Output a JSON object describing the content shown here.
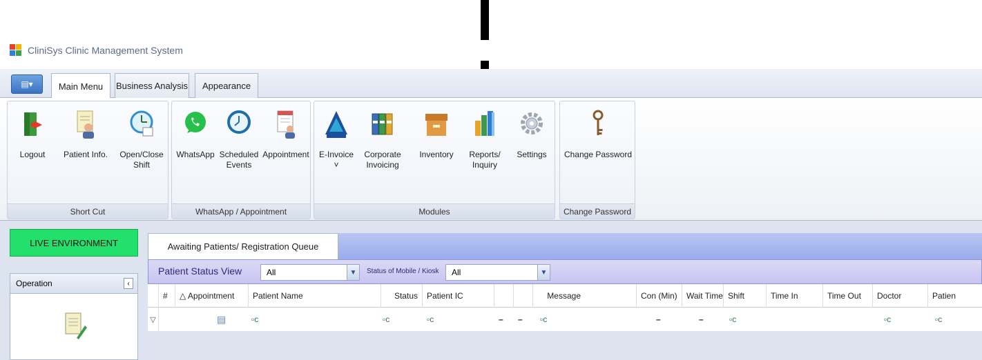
{
  "window": {
    "title": "CliniSys Clinic Management System"
  },
  "tabs": [
    {
      "label": "Main Menu",
      "active": true
    },
    {
      "label": "Business Analysis",
      "active": false
    },
    {
      "label": "Appearance",
      "active": false
    }
  ],
  "app_menu_glyph": "▤▾",
  "ribbon": {
    "groups": [
      {
        "label": "Short Cut",
        "buttons": [
          {
            "label": "Logout",
            "icon": "door-exit-icon"
          },
          {
            "label": "Patient Info.",
            "icon": "patient-doc-icon"
          },
          {
            "label": "Open/Close\nShift",
            "icon": "clock-calendar-icon"
          }
        ]
      },
      {
        "label": "WhatsApp / Appointment",
        "buttons": [
          {
            "label": "WhatsApp",
            "icon": "whatsapp-icon"
          },
          {
            "label": "Scheduled\nEvents",
            "icon": "clock-icon"
          },
          {
            "label": "Appointment",
            "icon": "calendar-user-icon"
          }
        ]
      },
      {
        "label": "Modules",
        "buttons": [
          {
            "label": "E-Invoice\n˅",
            "icon": "einvoice-logo-icon"
          },
          {
            "label": "Corporate\nInvoicing",
            "icon": "books-icon"
          },
          {
            "label": "Inventory",
            "icon": "box-icon"
          },
          {
            "label": "Reports/\nInquiry",
            "icon": "bar-chart-icon"
          },
          {
            "label": "Settings",
            "icon": "gear-icon"
          }
        ]
      },
      {
        "label": "Change Password",
        "buttons": [
          {
            "label": "Change Password",
            "icon": "key-icon"
          }
        ]
      }
    ]
  },
  "sidebar": {
    "environment_label": "LIVE ENVIRONMENT",
    "operation_label": "Operation",
    "collapse_glyph": "‹"
  },
  "queue": {
    "tab_label": "Awaiting Patients/ Registration Queue",
    "filters": {
      "patient_status_label": "Patient Status View",
      "patient_status_value": "All",
      "kiosk_label": "Status of Mobile / Kiosk",
      "kiosk_value": "All"
    },
    "columns": [
      "#",
      "△ Appointment",
      "Patient Name",
      "Status",
      "Patient IC",
      "",
      "",
      "Message",
      "Con (Min)",
      "Wait Time",
      "Shift",
      "Time In",
      "Time Out",
      "Doctor",
      "Patien"
    ],
    "filter_row": {
      "indicator": "▽",
      "cells": [
        "▤",
        "▫c",
        "▫c",
        "▫c",
        "–",
        "–",
        "▫c",
        "–",
        "–",
        "▫c",
        "",
        "",
        "▫c",
        "▫c"
      ]
    }
  }
}
